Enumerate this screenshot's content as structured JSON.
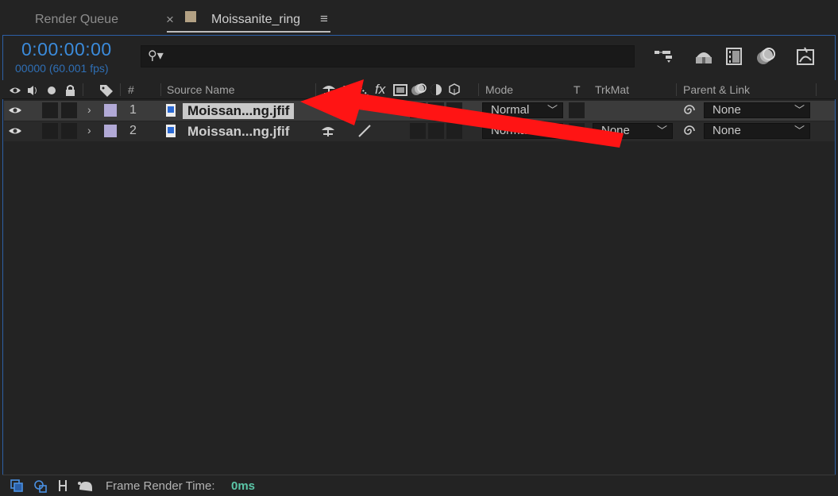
{
  "tabs": {
    "render_queue": "Render Queue",
    "close": "×",
    "composition": "Moissanite_ring",
    "menu": "≡"
  },
  "time": {
    "timecode": "0:00:00:00",
    "frames": "00000 (60.001 fps)"
  },
  "search": {
    "placeholder": "",
    "value": ""
  },
  "columns": {
    "number": "#",
    "source_name": "Source Name",
    "fx": "fx",
    "mode": "Mode",
    "t": "T",
    "trkmat": "TrkMat",
    "parent": "Parent & Link"
  },
  "layers": [
    {
      "number": "1",
      "name": "Moissan...ng.jfif",
      "mode": "Normal",
      "trkmat": "",
      "parent": "None",
      "selected": true
    },
    {
      "number": "2",
      "name": "Moissan...ng.jfif",
      "mode": "Normal",
      "trkmat": "None",
      "parent": "None",
      "selected": false
    }
  ],
  "footer": {
    "label": "Frame Render Time:",
    "value": "0ms"
  },
  "colors": {
    "timecode": "#3b8bdb",
    "label": "#b1a9d6",
    "arrow": "#ff1414",
    "render_time": "#5bc6a8"
  },
  "icons": [
    "eye-icon",
    "audio-icon",
    "solo-icon",
    "lock-icon",
    "label-icon",
    "expand-icon",
    "image-icon",
    "shy-icon",
    "collapse-icon",
    "quality-icon",
    "fx-icon",
    "motion-blur-icon",
    "adjustment-icon",
    "3d-icon",
    "parent-pickwhip-icon",
    "search-icon"
  ]
}
